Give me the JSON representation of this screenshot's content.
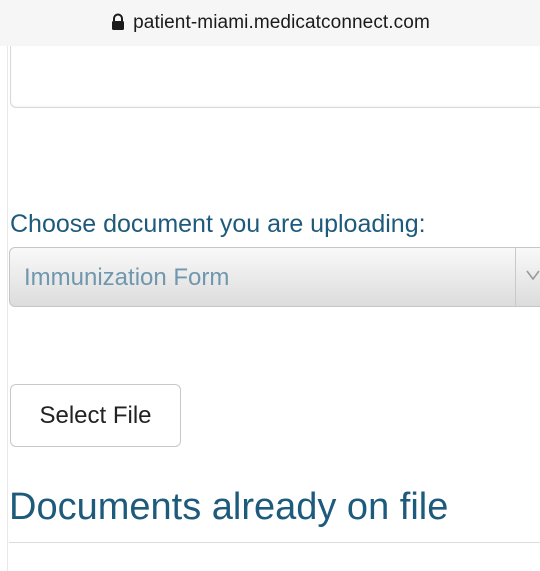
{
  "browser": {
    "url": "patient-miami.medicatconnect.com",
    "lock_icon": "lock-icon"
  },
  "form": {
    "document_label": "Choose document you are uploading:",
    "document_select": {
      "selected": "Immunization Form",
      "chevron_icon": "chevron-down-icon"
    },
    "select_file_label": "Select File"
  },
  "documents_section": {
    "heading": "Documents already on file"
  },
  "colors": {
    "heading": "#1d5a7c",
    "select_text": "#6f97ad",
    "url_bar_bg": "#f6f6f6"
  }
}
